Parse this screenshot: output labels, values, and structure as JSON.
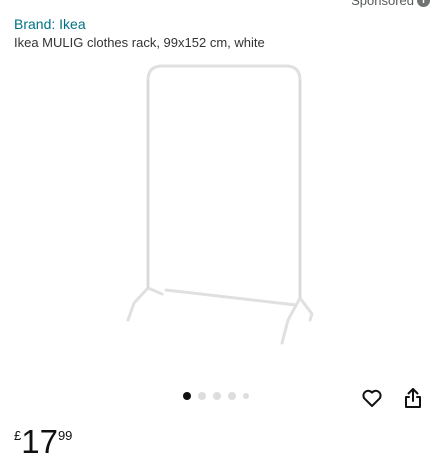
{
  "sponsored": {
    "label": "Sponsored",
    "icon": "info-icon"
  },
  "product": {
    "brand": "Brand: Ikea",
    "title": "Ikea MULIG clothes rack, 99x152 cm, white"
  },
  "carousel": {
    "total": 5,
    "active": 1
  },
  "actions": {
    "wishlist_icon": "heart-icon",
    "share_icon": "share-icon"
  },
  "price": {
    "currency": "£",
    "whole": "17",
    "fraction": "99"
  }
}
